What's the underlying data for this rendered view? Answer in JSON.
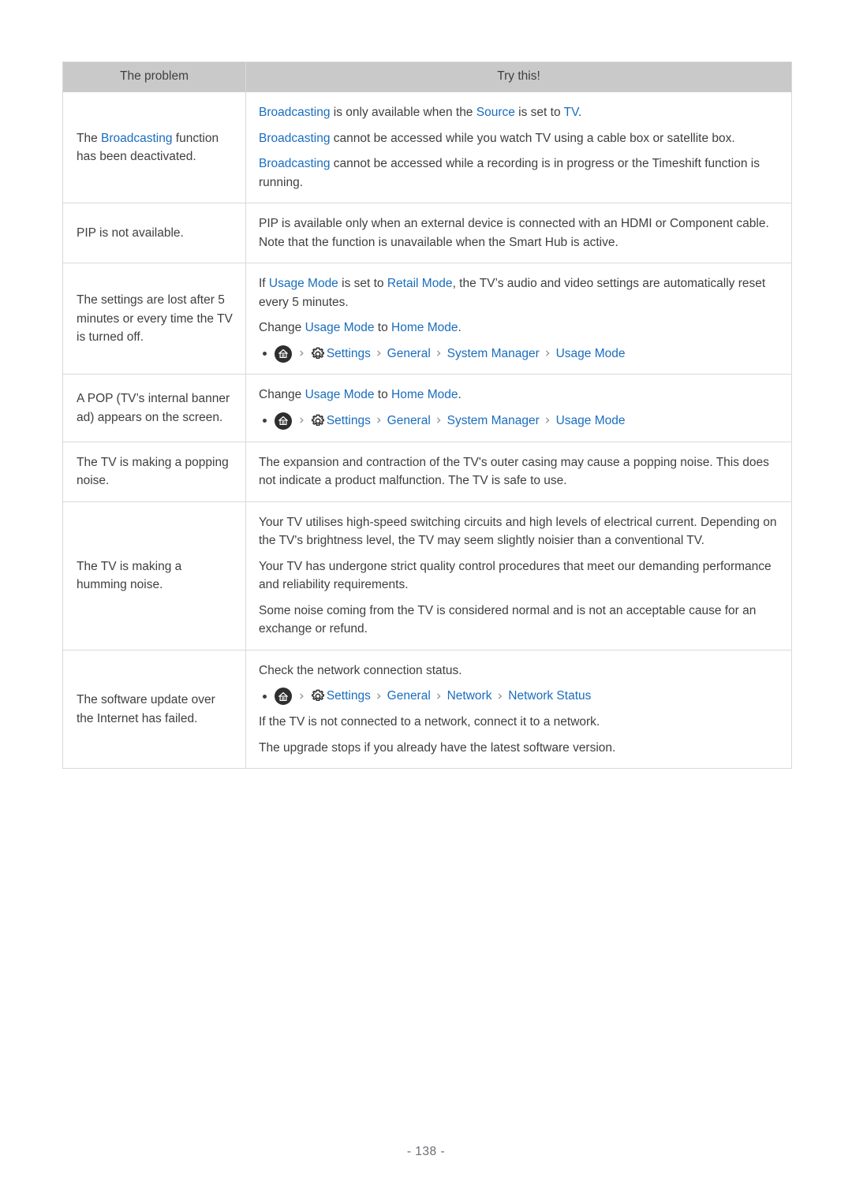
{
  "table": {
    "headers": [
      "The problem",
      "Try this!"
    ],
    "rows": [
      {
        "problem_parts": [
          {
            "t": "The ",
            "link": false
          },
          {
            "t": "Broadcasting",
            "link": true
          },
          {
            "t": " function has been deactivated.",
            "link": false
          }
        ],
        "lines": [
          {
            "parts": [
              {
                "t": "Broadcasting",
                "link": true
              },
              {
                "t": " is only available when the ",
                "link": false
              },
              {
                "t": "Source",
                "link": true
              },
              {
                "t": " is set to ",
                "link": false
              },
              {
                "t": "TV",
                "link": true
              },
              {
                "t": ".",
                "link": false
              }
            ]
          },
          {
            "parts": [
              {
                "t": "Broadcasting",
                "link": true
              },
              {
                "t": " cannot be accessed while you watch TV using a cable box or satellite box.",
                "link": false
              }
            ]
          },
          {
            "parts": [
              {
                "t": "Broadcasting",
                "link": true
              },
              {
                "t": " cannot be accessed while a recording is in progress or the Timeshift function is running.",
                "link": false
              }
            ]
          }
        ]
      },
      {
        "problem_parts": [
          {
            "t": "PIP is not available.",
            "link": false
          }
        ],
        "lines": [
          {
            "parts": [
              {
                "t": "PIP is available only when an external device is connected with an HDMI or Component cable. Note that the function is unavailable when the Smart Hub is active.",
                "link": false
              }
            ]
          }
        ]
      },
      {
        "problem_parts": [
          {
            "t": "The settings are lost after 5 minutes or every time the TV is turned off.",
            "link": false
          }
        ],
        "lines": [
          {
            "parts": [
              {
                "t": "If ",
                "link": false
              },
              {
                "t": "Usage Mode",
                "link": true
              },
              {
                "t": " is set to ",
                "link": false
              },
              {
                "t": "Retail Mode",
                "link": true
              },
              {
                "t": ", the TV’s audio and video settings are automatically reset every 5 minutes.",
                "link": false
              }
            ]
          },
          {
            "parts": [
              {
                "t": "Change ",
                "link": false
              },
              {
                "t": "Usage Mode",
                "link": true
              },
              {
                "t": " to ",
                "link": false
              },
              {
                "t": "Home Mode",
                "link": true
              },
              {
                "t": ".",
                "link": false
              }
            ]
          }
        ],
        "path": [
          "Settings",
          "General",
          "System Manager",
          "Usage Mode"
        ]
      },
      {
        "problem_parts": [
          {
            "t": "A POP (TV’s internal banner ad) appears on the screen.",
            "link": false
          }
        ],
        "lines": [
          {
            "parts": [
              {
                "t": "Change ",
                "link": false
              },
              {
                "t": "Usage Mode",
                "link": true
              },
              {
                "t": " to ",
                "link": false
              },
              {
                "t": "Home Mode",
                "link": true
              },
              {
                "t": ".",
                "link": false
              }
            ]
          }
        ],
        "path": [
          "Settings",
          "General",
          "System Manager",
          "Usage Mode"
        ]
      },
      {
        "problem_parts": [
          {
            "t": "The TV is making a popping noise.",
            "link": false
          }
        ],
        "lines": [
          {
            "parts": [
              {
                "t": "The expansion and contraction of the TV's outer casing may cause a popping noise. This does not indicate a product malfunction. The TV is safe to use.",
                "link": false
              }
            ]
          }
        ]
      },
      {
        "problem_parts": [
          {
            "t": "The TV is making a humming noise.",
            "link": false
          }
        ],
        "lines": [
          {
            "parts": [
              {
                "t": "Your TV utilises high-speed switching circuits and high levels of electrical current. Depending on the TV's brightness level, the TV may seem slightly noisier than a conventional TV.",
                "link": false
              }
            ]
          },
          {
            "parts": [
              {
                "t": "Your TV has undergone strict quality control procedures that meet our demanding performance and reliability requirements.",
                "link": false
              }
            ]
          },
          {
            "parts": [
              {
                "t": "Some noise coming from the TV is considered normal and is not an acceptable cause for an exchange or refund.",
                "link": false
              }
            ]
          }
        ]
      },
      {
        "problem_parts": [
          {
            "t": "The software update over the Internet has failed.",
            "link": false
          }
        ],
        "lines": [
          {
            "parts": [
              {
                "t": "Check the network connection status.",
                "link": false
              }
            ]
          }
        ],
        "path": [
          "Settings",
          "General",
          "Network",
          "Network Status"
        ],
        "lines_after": [
          {
            "parts": [
              {
                "t": "If the TV is not connected to a network, connect it to a network.",
                "link": false
              }
            ]
          },
          {
            "parts": [
              {
                "t": "The upgrade stops if you already have the latest software version.",
                "link": false
              }
            ]
          }
        ]
      }
    ]
  },
  "icons": {
    "home": "home-icon",
    "gear": "gear-icon",
    "chevron": "›"
  },
  "colors": {
    "link": "#1a6dbe",
    "text": "#3f3f3f",
    "header_bg": "#c9c9c9",
    "border": "#d9d9d9"
  },
  "footer": {
    "page_number": "- 138 -"
  }
}
